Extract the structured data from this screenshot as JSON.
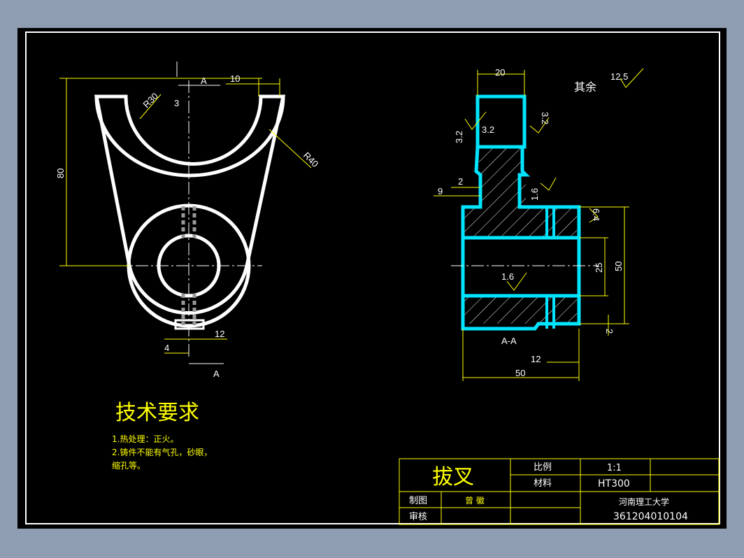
{
  "colors": {
    "background": "#8e9db1",
    "paper": "#000000",
    "outline": "#ffffff",
    "section": "#00e5ff",
    "dimension": "#ffff00",
    "text": "#ffffff"
  },
  "drawing": {
    "part_name": "拔叉",
    "scale_label": "比例",
    "scale_value": "1:1",
    "material_label": "材料",
    "material_value": "HT300",
    "drawn_label": "制图",
    "drawn_by": "曾 徽",
    "checked_label": "审核",
    "school": "河南理工大学",
    "student_id": "361204010104"
  },
  "front_view": {
    "section_mark_top": "A",
    "section_mark_bottom": "A",
    "dims": {
      "width_top": "10",
      "offset_top": "3",
      "r_inner": "R30",
      "r_outer": "R40",
      "height": "80",
      "slot_width": "12",
      "slot_offset": "4"
    }
  },
  "section_view": {
    "label": "A-A",
    "roughness_rest_label": "其余",
    "roughness_rest_value": "12.5",
    "dims": {
      "top_width": "20",
      "step_2": "2",
      "step_9": "9",
      "ra_32_left": "3.2",
      "ra_32_mid": "3.2",
      "ra_32_right": "3.2",
      "ra_16": "1.6",
      "ra_64": "6.4",
      "ra_16_bore": "1.6",
      "bore": "25",
      "height_50": "50",
      "step_bottom_2": "2",
      "slot_12": "12",
      "width_50": "50"
    }
  },
  "requirements": {
    "title": "技术要求",
    "line1": "1.热处理：正火。",
    "line2": "2.铸件不能有气孔，砂眼，",
    "line3": "缩孔等。"
  }
}
